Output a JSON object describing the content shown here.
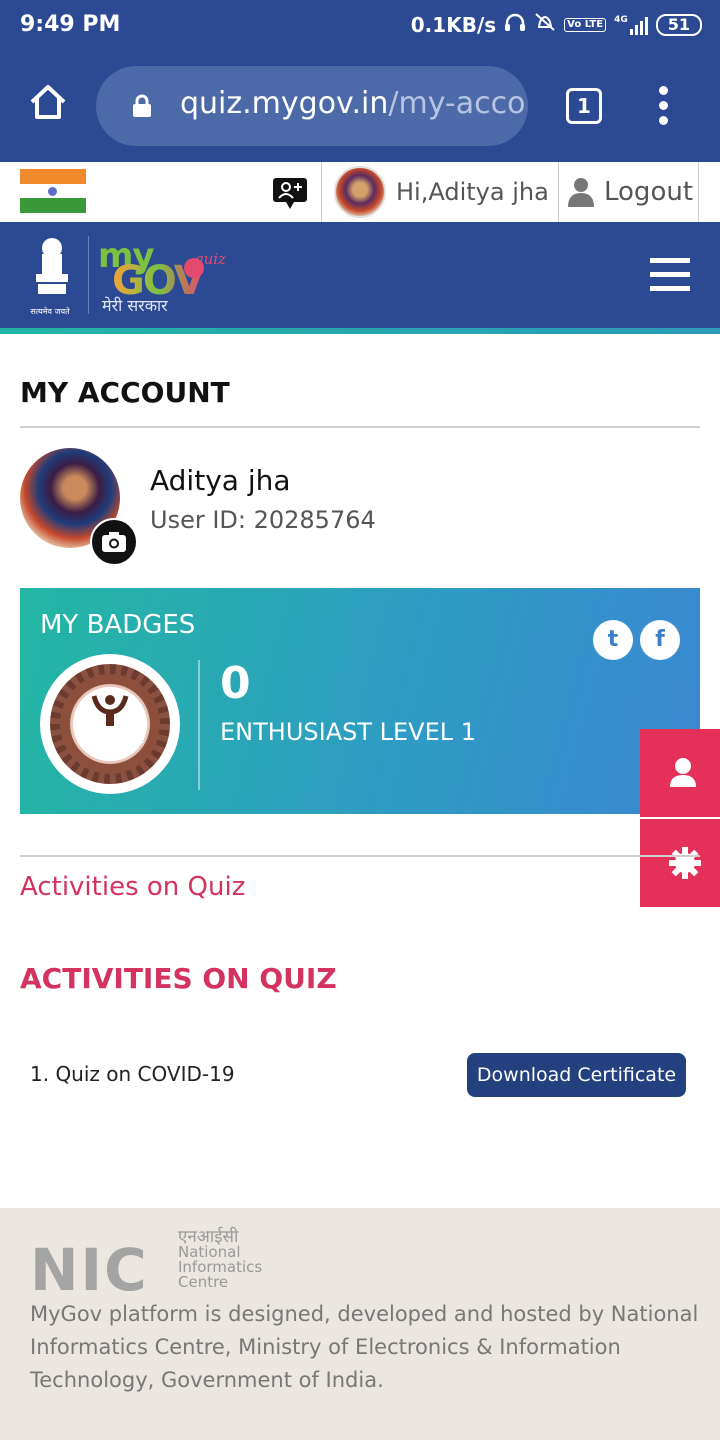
{
  "status_bar": {
    "time": "9:49 PM",
    "net_speed": "0.1KB/s",
    "volte": "Vo LTE",
    "network": "4G",
    "battery": "51"
  },
  "browser": {
    "url_host": "quiz.mygov.in",
    "url_path": "/my-acco",
    "tab_count": "1"
  },
  "top_strip": {
    "greeting": "Hi,Aditya jha",
    "logout_label": "Logout"
  },
  "header": {
    "logo_my": "my",
    "logo_gov": "GOV",
    "logo_quiz": "quiz",
    "logo_hindi": "मेरी सरकार",
    "emblem_caption": "सत्यमेव जयते"
  },
  "account": {
    "title": "MY ACCOUNT",
    "name": "Aditya jha",
    "user_id": "User ID: 20285764"
  },
  "badges": {
    "title": "MY BADGES",
    "badge_label": "Enthusiast",
    "count": "0",
    "level": "ENTHUSIAST LEVEL 1",
    "twitter": "t",
    "facebook": "f"
  },
  "activities": {
    "link": "Activities on Quiz",
    "heading": "ACTIVITIES ON QUIZ",
    "items": [
      {
        "label": "1. Quiz on COVID-19",
        "button": "Download Certificate"
      }
    ]
  },
  "footer": {
    "nic_letters": "NIC",
    "nic_hindi": "एनआईसी",
    "nic_line1": "National",
    "nic_line2": "Informatics",
    "nic_line3": "Centre",
    "text": "MyGov platform is designed, developed and hosted by National Informatics Centre, Ministry of Electronics & Information Technology, Government of India."
  },
  "colors": {
    "brand_blue": "#2b4a93",
    "accent_pink": "#d3335e",
    "side_button": "#e5305a",
    "button_navy": "#23407f"
  }
}
